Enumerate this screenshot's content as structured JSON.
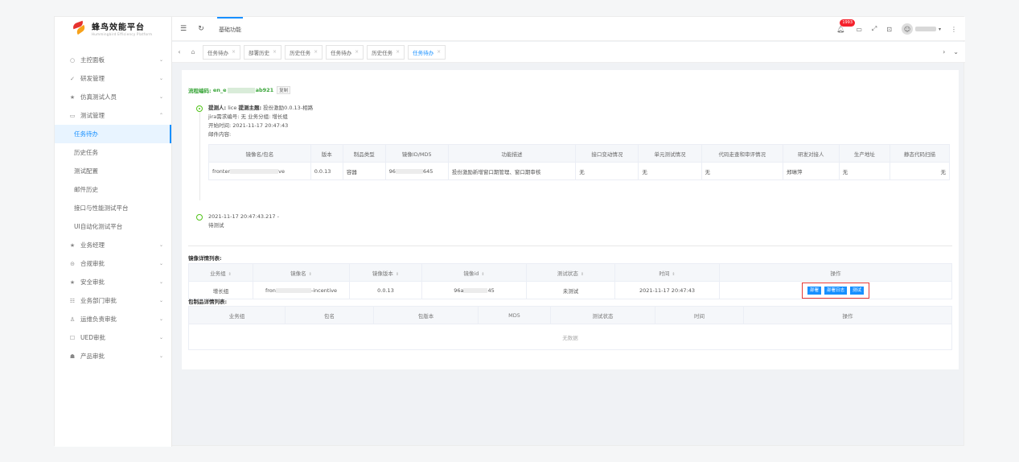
{
  "logo": {
    "title": "蜂鸟效能平台",
    "subtitle": "Hummingbird Efficiency Platform"
  },
  "sidebar": {
    "items": [
      {
        "icon": "○",
        "label": "主控面板",
        "chev": "⌄"
      },
      {
        "icon": "✓",
        "label": "研发管理",
        "chev": "⌄"
      },
      {
        "icon": "★",
        "label": "仿真测试人员",
        "chev": "⌄"
      },
      {
        "icon": "▭",
        "label": "测试管理",
        "chev": "⌃"
      }
    ],
    "subitems": [
      "任务待办",
      "历史任务",
      "测试配置",
      "邮件历史",
      "接口与性能测试平台",
      "UI自动化测试平台"
    ],
    "items2": [
      {
        "icon": "★",
        "label": "业务经理",
        "chev": "⌄"
      },
      {
        "icon": "⊝",
        "label": "合规审批",
        "chev": "⌄"
      },
      {
        "icon": "★",
        "label": "安全审批",
        "chev": "⌄"
      },
      {
        "icon": "☷",
        "label": "业务部门审批",
        "chev": "⌄"
      },
      {
        "icon": "♙",
        "label": "运维负责审批",
        "chev": "⌄"
      },
      {
        "icon": "☐",
        "label": "UED审批",
        "chev": "⌄"
      },
      {
        "icon": "☗",
        "label": "产品审批",
        "chev": "⌄"
      }
    ]
  },
  "topbar": {
    "title": "基础功能",
    "badge": "1993"
  },
  "tabs": [
    "任务待办",
    "部署历史",
    "历史任务",
    "任务待办",
    "历史任务",
    "任务待办"
  ],
  "flow": {
    "label": "流程编码:",
    "code_prefix": "en_e",
    "code_suffix": "ab921",
    "copy": "复制"
  },
  "timeline": {
    "line1_a": "提测人:",
    "line1_b": "lice",
    "line1_c": "提测主题:",
    "line1_d": "投份激励0.0.13-相路",
    "line2": "jira需求编号: 无 业务分组: 增长组",
    "line3": "开始时间: 2021-11-17 20:47:43",
    "line4": "邮件内容:",
    "mail_headers": [
      "镜像名/包名",
      "版本",
      "制品类型",
      "镜像ID/MD5",
      "功能描述",
      "接口变动情况",
      "单元测试情况",
      "代码走查和审评情况",
      "研发对接人",
      "生产地址",
      "静态代码扫描"
    ],
    "mail_row": [
      "fronter",
      "ve",
      "0.0.13",
      "容器",
      "96",
      "645",
      "投份激励新增窗口期管理、窗口期审核",
      "无",
      "无",
      "无",
      "郑琳萍",
      "无",
      "无"
    ],
    "t2_line1": "2021-11-17 20:47:43.217 -",
    "t2_line2": "待测试"
  },
  "image_list": {
    "title": "镜像详情列表:",
    "headers": [
      "业务组",
      "镜像名",
      "镜像版本",
      "镜像id",
      "测试状态",
      "时间",
      "操作"
    ],
    "row": [
      "增长组",
      "fron",
      "-incentive",
      "0.0.13",
      "96a",
      "45",
      "未测试",
      "2021-11-17 20:47:43"
    ],
    "ops": [
      "部署",
      "部署日志",
      "测试"
    ]
  },
  "pkg_list": {
    "title": "包制品详情列表:",
    "headers": [
      "业务组",
      "包名",
      "包版本",
      "MD5",
      "测试状态",
      "时间",
      "操作"
    ],
    "empty": "无数据"
  },
  "colors": {
    "accent": "#1890ff",
    "green": "#52c41a",
    "highlight": "#e53935"
  }
}
